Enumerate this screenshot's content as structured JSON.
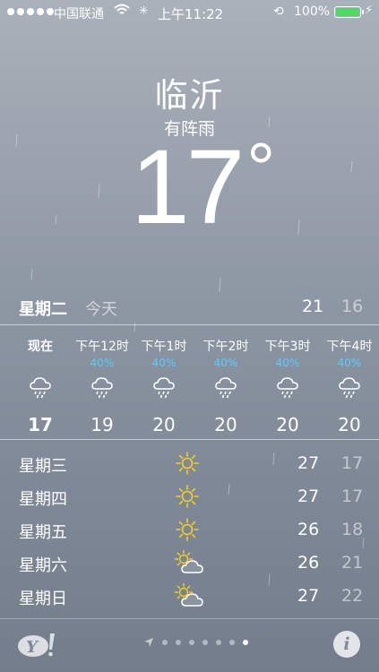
{
  "status_bar": {
    "carrier": "中国联通",
    "time": "上午11:22",
    "battery_percent": "100%",
    "signal_bars": 5,
    "battery_color": "#4cd964"
  },
  "current": {
    "city": "临沂",
    "condition": "有阵雨",
    "temperature": "17",
    "degree_symbol": "°"
  },
  "today": {
    "weekday": "星期二",
    "label": "今天",
    "high": "21",
    "low": "16"
  },
  "hourly": [
    {
      "time": "现在",
      "precip": "",
      "icon": "rain-cloud-icon",
      "temp": "17"
    },
    {
      "time": "下午12时",
      "precip": "40%",
      "icon": "rain-cloud-icon",
      "temp": "19"
    },
    {
      "time": "下午1时",
      "precip": "40%",
      "icon": "rain-cloud-icon",
      "temp": "20"
    },
    {
      "time": "下午2时",
      "precip": "40%",
      "icon": "rain-cloud-icon",
      "temp": "20"
    },
    {
      "time": "下午3时",
      "precip": "40%",
      "icon": "rain-cloud-icon",
      "temp": "20"
    },
    {
      "time": "下午4时",
      "precip": "40%",
      "icon": "rain-cloud-icon",
      "temp": "20"
    }
  ],
  "daily": [
    {
      "day": "星期三",
      "icon": "sun-icon",
      "high": "27",
      "low": "17"
    },
    {
      "day": "星期四",
      "icon": "sun-icon",
      "high": "27",
      "low": "17"
    },
    {
      "day": "星期五",
      "icon": "sun-icon",
      "high": "26",
      "low": "18"
    },
    {
      "day": "星期六",
      "icon": "partly-cloudy-icon",
      "high": "26",
      "low": "21"
    },
    {
      "day": "星期日",
      "icon": "partly-cloudy-icon",
      "high": "27",
      "low": "22"
    }
  ],
  "footer": {
    "logo_text": "Y!",
    "info_label": "i",
    "page_count": 7,
    "active_page": 7
  },
  "colors": {
    "precip": "#5ec8ff",
    "sun": "#f5d020"
  }
}
